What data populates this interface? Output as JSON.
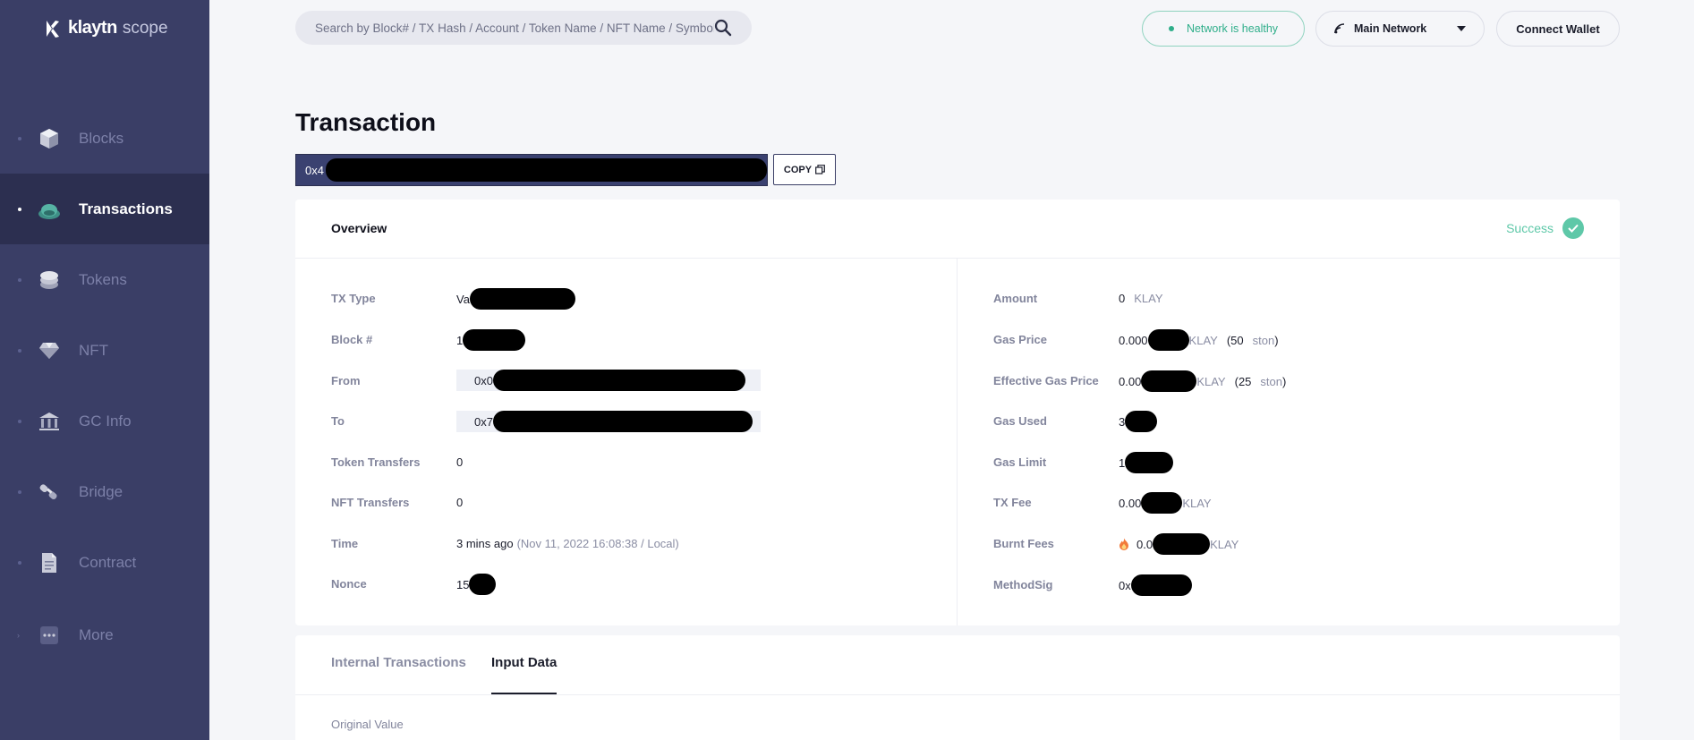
{
  "sidebar": {
    "brand": "klaytn",
    "brand_suffix": "scope",
    "items": [
      {
        "label": "Blocks",
        "icon": "cube-icon"
      },
      {
        "label": "Transactions",
        "icon": "transactions-icon",
        "active": true
      },
      {
        "label": "Tokens",
        "icon": "coins-icon"
      },
      {
        "label": "NFT",
        "icon": "diamond-icon"
      },
      {
        "label": "GC Info",
        "icon": "bank-icon"
      },
      {
        "label": "Bridge",
        "icon": "bridge-icon"
      },
      {
        "label": "Contract",
        "icon": "document-icon"
      },
      {
        "label": "More",
        "icon": "more-icon"
      }
    ]
  },
  "header": {
    "search_placeholder": "Search by Block# / TX Hash / Account / Token Name / NFT Name / Symbol",
    "network_status": "Network is healthy",
    "network_select": "Main Network",
    "connect_wallet": "Connect Wallet"
  },
  "page": {
    "title": "Transaction",
    "hash_prefix": "0x4",
    "copy_label": "COPY"
  },
  "overview": {
    "title": "Overview",
    "status": "Success",
    "left": {
      "tx_type": {
        "label": "TX Type",
        "value": "Va"
      },
      "block": {
        "label": "Block #",
        "value": "1"
      },
      "from": {
        "label": "From",
        "value": "0x0"
      },
      "to": {
        "label": "To",
        "value": "0x7"
      },
      "token_transfers": {
        "label": "Token Transfers",
        "value": "0"
      },
      "nft_transfers": {
        "label": "NFT Transfers",
        "value": "0"
      },
      "time": {
        "label": "Time",
        "value": "3 mins ago",
        "detail": "(Nov 11, 2022 16:08:38 / Local)"
      },
      "nonce": {
        "label": "Nonce",
        "value": "15"
      }
    },
    "right": {
      "amount": {
        "label": "Amount",
        "value": "0",
        "unit": "KLAY"
      },
      "gas_price": {
        "label": "Gas Price",
        "value": "0.000",
        "unit": "KLAY",
        "paren_open": "(",
        "ston_value": "50",
        "ston_unit": "ston",
        "paren_close": ")"
      },
      "effective_gas_price": {
        "label": "Effective Gas Price",
        "value": "0.00",
        "unit": "KLAY",
        "paren_open": "(",
        "ston_value": "25",
        "ston_unit": "ston",
        "paren_close": ")"
      },
      "gas_used": {
        "label": "Gas Used",
        "value": "3"
      },
      "gas_limit": {
        "label": "Gas Limit",
        "value": "1"
      },
      "tx_fee": {
        "label": "TX Fee",
        "value": "0.00",
        "unit": "KLAY"
      },
      "burnt_fees": {
        "label": "Burnt Fees",
        "value": "0.0",
        "unit": "KLAY"
      },
      "method_sig": {
        "label": "MethodSig",
        "value": "0x"
      }
    }
  },
  "tabs": {
    "items": [
      "Internal Transactions",
      "Input Data"
    ],
    "active": "Input Data",
    "original_value_label": "Original Value"
  },
  "colors": {
    "sidebar_bg": "#3a3e66",
    "sidebar_active_bg": "#2c2f50",
    "success": "#5ec8a8",
    "hash_bg": "#3a4170"
  }
}
